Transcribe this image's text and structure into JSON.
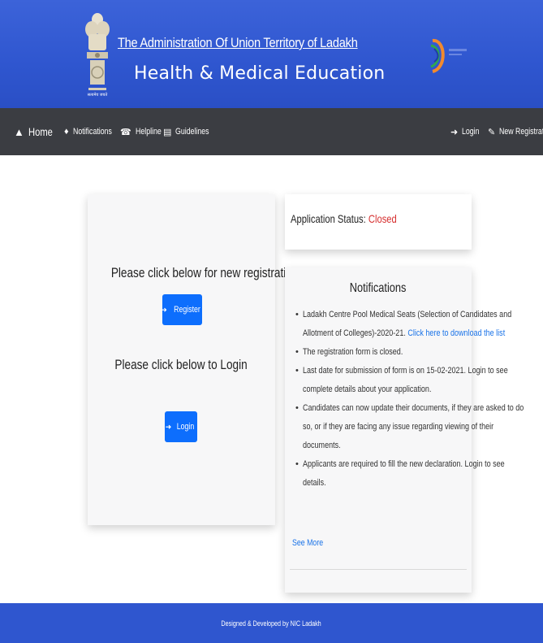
{
  "header": {
    "title_line1": "The Administration Of Union Territory of Ladakh",
    "title_line2": "Health & Medical Education",
    "emblem_caption": "सत्यमेव जयते"
  },
  "nav": {
    "home": "Home",
    "notifications": "Notifications",
    "helpline": "Helpline",
    "guidelines": "Guidelines",
    "login": "Login",
    "new_registration": "New Registration"
  },
  "left_card": {
    "register_prompt": "Please click below for new registration",
    "register_button": "Register",
    "login_prompt": "Please click below to Login",
    "login_button": "Login"
  },
  "status": {
    "label": "Application Status:",
    "value": "Closed",
    "value_color": "#d62f2f"
  },
  "notifications": {
    "title": "Notifications",
    "items": [
      {
        "lines": [
          "Ladakh Centre Pool Medical Seats (Selection of Candidates and",
          "Allotment of Colleges)-2020-21."
        ],
        "link": "Click here to download the list"
      },
      {
        "lines": [
          "The registration form is closed."
        ]
      },
      {
        "lines": [
          "Last date for submission of form is on 15-02-2021. Login to see",
          "complete details about your application."
        ]
      },
      {
        "lines": [
          "Candidates can now update their documents, if they are asked to do",
          "so, or if they are facing any issue regarding viewing of their",
          "documents."
        ]
      },
      {
        "lines": [
          "Applicants are required to fill the new declaration. Login to see",
          "details."
        ]
      }
    ],
    "see_more": "See More"
  },
  "footer": {
    "text": "Designed & Developed by NIC Ladakh"
  },
  "colors": {
    "header_blue": "#2f56cf",
    "navbar": "#3b3d42",
    "button_blue": "#0d6efd",
    "link_blue": "#1a73e8"
  }
}
